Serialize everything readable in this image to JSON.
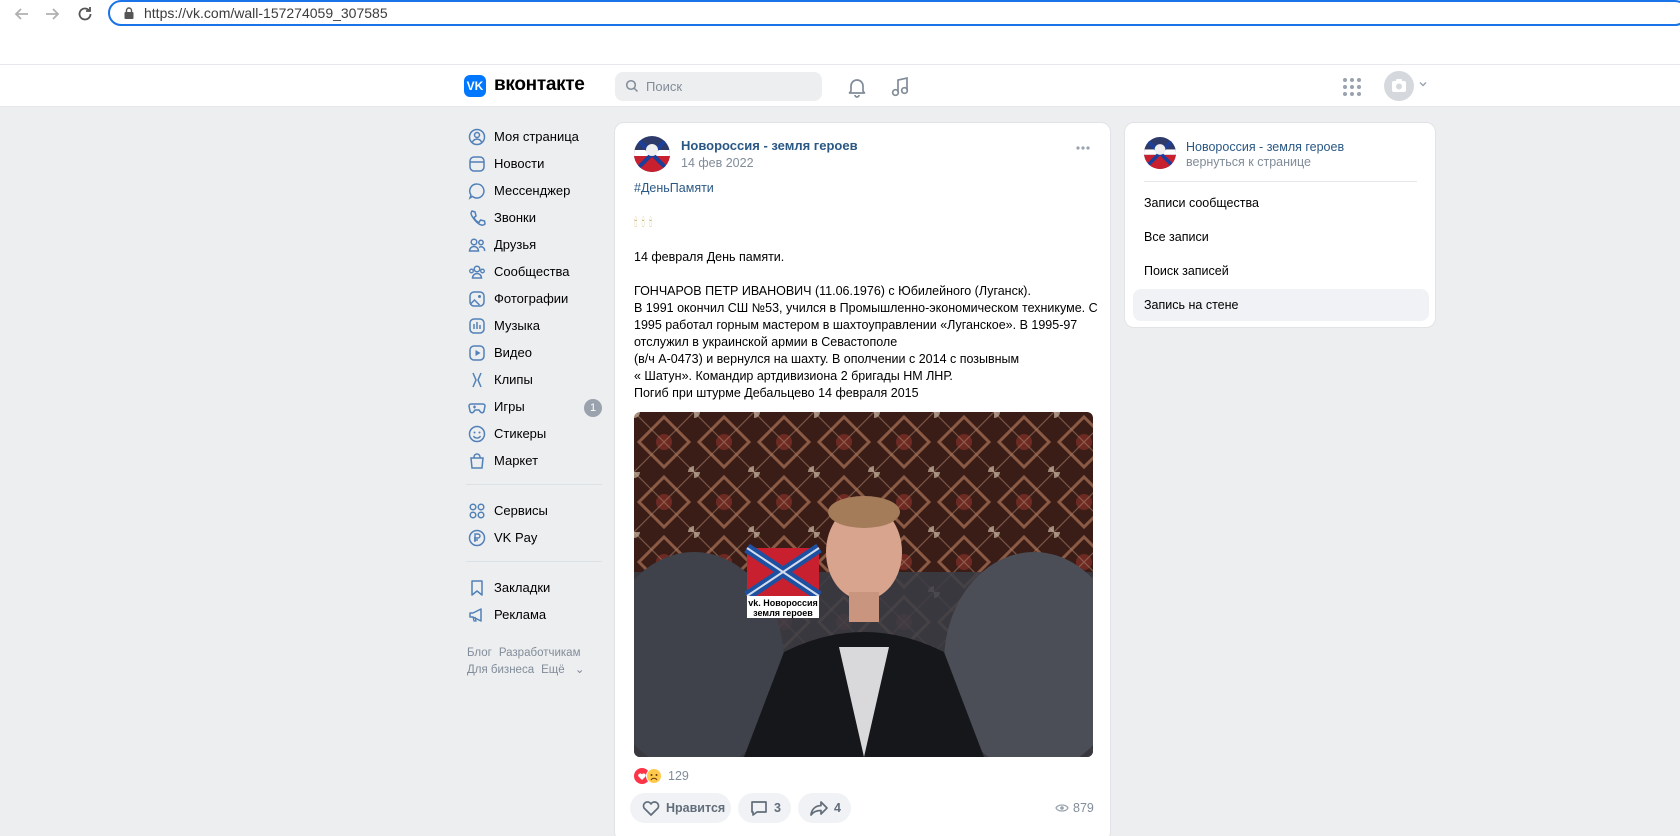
{
  "browser": {
    "url": "https://vk.com/wall-157274059_307585"
  },
  "header": {
    "logo_text": "вконтакте",
    "search_placeholder": "Поиск"
  },
  "sidebar": {
    "items": [
      {
        "label": "Моя страница",
        "icon": "user-icon"
      },
      {
        "label": "Новости",
        "icon": "news-icon"
      },
      {
        "label": "Мессенджер",
        "icon": "message-icon"
      },
      {
        "label": "Звонки",
        "icon": "phone-icon"
      },
      {
        "label": "Друзья",
        "icon": "friends-icon"
      },
      {
        "label": "Сообщества",
        "icon": "communities-icon"
      },
      {
        "label": "Фотографии",
        "icon": "photo-icon"
      },
      {
        "label": "Музыка",
        "icon": "music-icon"
      },
      {
        "label": "Видео",
        "icon": "video-icon"
      },
      {
        "label": "Клипы",
        "icon": "clips-icon"
      },
      {
        "label": "Игры",
        "icon": "games-icon",
        "badge": "1"
      },
      {
        "label": "Стикеры",
        "icon": "sticker-icon"
      },
      {
        "label": "Маркет",
        "icon": "market-icon"
      }
    ],
    "items2": [
      {
        "label": "Сервисы",
        "icon": "services-icon"
      },
      {
        "label": "VK Pay",
        "icon": "vkpay-icon"
      }
    ],
    "items3": [
      {
        "label": "Закладки",
        "icon": "bookmark-icon"
      },
      {
        "label": "Реклама",
        "icon": "ads-icon"
      }
    ],
    "footer": {
      "blog": "Блог",
      "developers": "Разработчикам",
      "business": "Для бизнеса",
      "more": "Ещё"
    }
  },
  "post": {
    "author": "Новороссия - земля героев",
    "date": "14 фев 2022",
    "hashtag": "#ДеньПамяти",
    "candles": "🕯🕯🕯",
    "lines": [
      "14 февраля День памяти.",
      "",
      "ГОНЧАРОВ ПЕТР ИВАНОВИЧ (11.06.1976) с Юбилейного (Луганск).",
      "В 1991 окончил СШ №53, учился в Промышленно-экономическом техникуме. С",
      "1995 работал горным мастером в шахтоуправлении «Луганское». В 1995-97",
      "отслужил в украинской армии в Севастополе",
      "(в/ч А-0473) и вернулся на шахту. В ополчении с 2014 с позывным",
      "« Шатун». Командир артдивизиона 2 бригады НМ ЛНР.",
      "Погиб при штурме Дебальцево 14 февраля 2015"
    ],
    "photo_watermark_line1": "vk. Новороссия",
    "photo_watermark_line2": "земля героев",
    "reactions_count": "129",
    "like_label": "Нравится",
    "comments_count": "3",
    "shares_count": "4",
    "views_count": "879"
  },
  "right_panel": {
    "community_name": "Новороссия - земля героев",
    "back_label": "вернуться к странице",
    "items": [
      {
        "label": "Записи сообщества"
      },
      {
        "label": "Все записи"
      },
      {
        "label": "Поиск записей"
      },
      {
        "label": "Запись на стене"
      }
    ]
  },
  "colors": {
    "accent": "#0077ff",
    "link": "#2a5885",
    "background": "#edeef0",
    "url_border": "#1a73e8"
  }
}
